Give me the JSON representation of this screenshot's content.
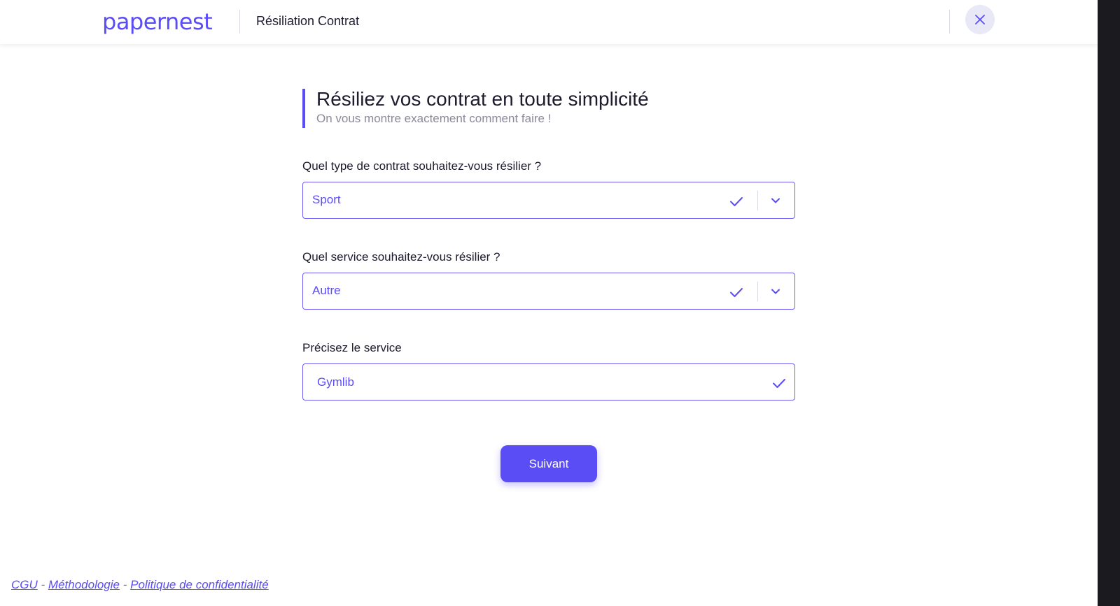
{
  "header": {
    "logo_text": "papernest",
    "title": "Résiliation Contrat",
    "close_icon": "close-icon"
  },
  "intro": {
    "title": "Résiliez vos contrat en toute simplicité",
    "subtitle": "On vous montre exactement comment faire !"
  },
  "form": {
    "contract_type": {
      "label": "Quel type de contrat souhaitez-vous résilier ?",
      "value": "Sport"
    },
    "service": {
      "label": "Quel service souhaitez-vous résilier ?",
      "value": "Autre"
    },
    "service_detail": {
      "label": "Précisez le service",
      "value": "Gymlib"
    },
    "next_label": "Suivant"
  },
  "footer": {
    "links": [
      "CGU",
      "Méthodologie",
      "Politique de confidentialité"
    ],
    "separator": "-"
  },
  "colors": {
    "accent": "#5b4df5",
    "border": "#6a5df6",
    "muted_text": "#8a8a9a",
    "close_bg": "#e8e8f6"
  }
}
